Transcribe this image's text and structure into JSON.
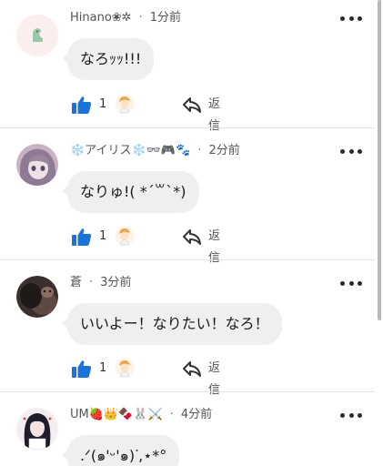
{
  "comments": [
    {
      "username": "Hinano❀✲",
      "time": "1分前",
      "text": "なろｯｯ!!!",
      "likes": "1",
      "reply_label": "返信"
    },
    {
      "username": "❄️アイリス❄️👓🎮🐾",
      "time": "2分前",
      "text": "なりゅ!( *´꒳`*)",
      "likes": "1",
      "reply_label": "返信"
    },
    {
      "username": "蒼",
      "time": "3分前",
      "text": "いいよー！なりたい！なろ！",
      "likes": "1",
      "reply_label": "返信"
    },
    {
      "username": "UM🍓👑🍫🐰⚔️",
      "time": "4分前",
      "text": ".ᐟ(๑'ᵕ'๑)ᐝ,⋆*°",
      "likes": "",
      "reply_label": ""
    }
  ],
  "separator": "·",
  "icons": {
    "like": "thumbs-up-icon",
    "reply": "reply-arrow-icon",
    "more": "more-options-icon",
    "liker": "liker-avatar-icon"
  },
  "colors": {
    "accent": "#1a73d9",
    "bubble": "#efefef",
    "divider": "#e3e3e3"
  }
}
